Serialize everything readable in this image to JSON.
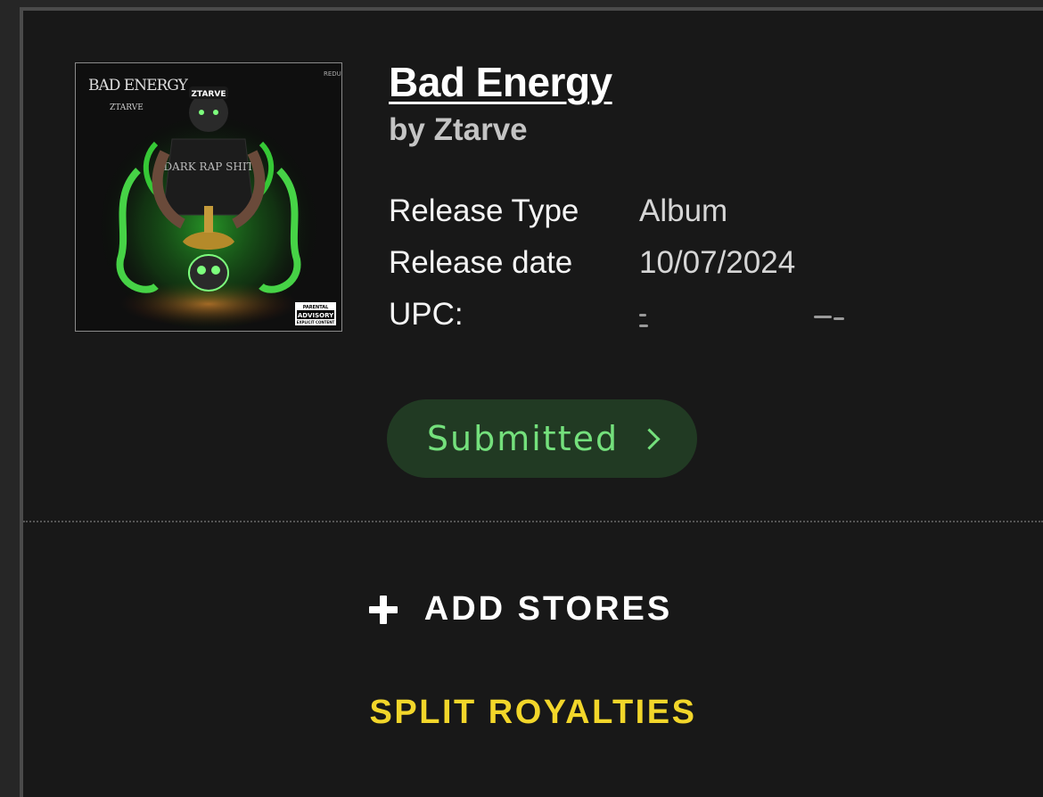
{
  "release": {
    "title": "Bad Energy",
    "artist": "by Ztarve",
    "cover_art": {
      "title_text": "BAD ENERGY",
      "artist_text": "ZTARVE",
      "corner_text": "REDUX",
      "cap_text": "ZTARVE",
      "shirt_text": "DARK RAP SHIT",
      "advisory_top": "PARENTAL",
      "advisory_main": "ADVISORY",
      "advisory_bottom": "EXPLICIT CONTENT"
    },
    "details": [
      {
        "label": "Release Type",
        "value": "Album"
      },
      {
        "label": "Release date",
        "value": "10/07/2024"
      },
      {
        "label": "UPC:",
        "value": ""
      }
    ]
  },
  "status": {
    "label": "Submitted",
    "color": "#74e07c",
    "background": "#213a23"
  },
  "actions": {
    "add_stores_label": "ADD STORES",
    "split_royalties_label": "SPLIT ROYALTIES"
  },
  "colors": {
    "background": "#181818",
    "accent_yellow": "#f2d62a",
    "accent_green": "#74e07c"
  }
}
